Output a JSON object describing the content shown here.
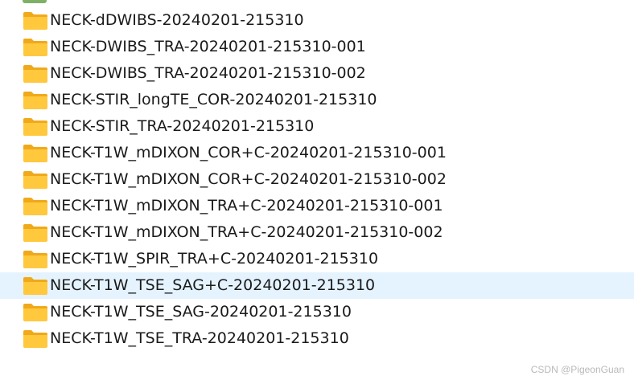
{
  "folders": [
    {
      "label": "NECK-dDWIBS-20240201-215310",
      "selected": false
    },
    {
      "label": "NECK-DWIBS_TRA-20240201-215310-001",
      "selected": false
    },
    {
      "label": "NECK-DWIBS_TRA-20240201-215310-002",
      "selected": false
    },
    {
      "label": "NECK-STIR_longTE_COR-20240201-215310",
      "selected": false
    },
    {
      "label": "NECK-STIR_TRA-20240201-215310",
      "selected": false
    },
    {
      "label": "NECK-T1W_mDIXON_COR+C-20240201-215310-001",
      "selected": false
    },
    {
      "label": "NECK-T1W_mDIXON_COR+C-20240201-215310-002",
      "selected": false
    },
    {
      "label": "NECK-T1W_mDIXON_TRA+C-20240201-215310-001",
      "selected": false
    },
    {
      "label": "NECK-T1W_mDIXON_TRA+C-20240201-215310-002",
      "selected": false
    },
    {
      "label": "NECK-T1W_SPIR_TRA+C-20240201-215310",
      "selected": false
    },
    {
      "label": "NECK-T1W_TSE_SAG+C-20240201-215310",
      "selected": true
    },
    {
      "label": "NECK-T1W_TSE_SAG-20240201-215310",
      "selected": false
    },
    {
      "label": "NECK-T1W_TSE_TRA-20240201-215310",
      "selected": false
    }
  ],
  "icons": {
    "folder": "folder-icon",
    "partial_top": "file-icon"
  },
  "colors": {
    "folder_body": "#FFC83D",
    "folder_tab": "#F0A91A",
    "selected_row": "#E5F3FF",
    "text": "#1A1A1A",
    "watermark": "#B9B9B9"
  },
  "watermark": "CSDN @PigeonGuan"
}
